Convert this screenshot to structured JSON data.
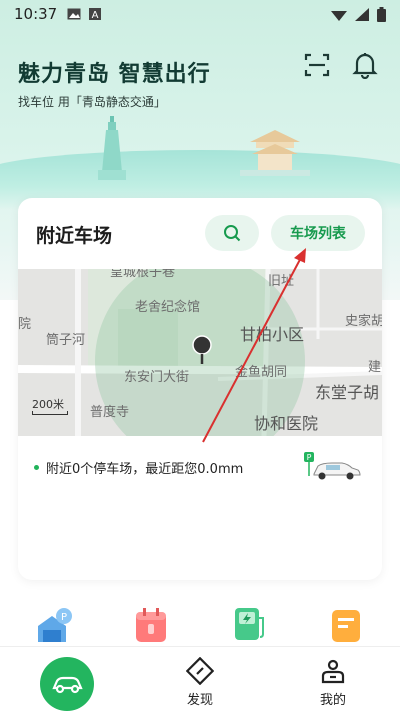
{
  "status_bar": {
    "time": "10:37",
    "left_icons": [
      "image-icon",
      "a-badge-icon"
    ],
    "right_icons": [
      "wifi-icon",
      "signal-icon",
      "battery-icon"
    ]
  },
  "header": {
    "title": "魅力青岛 智慧出行",
    "subtitle": "找车位 用「青岛静态交通」",
    "scan_icon": "scan-icon",
    "bell_icon": "bell-icon"
  },
  "nearby_card": {
    "title": "附近车场",
    "search_icon": "search-icon",
    "list_button_label": "车场列表",
    "map": {
      "labels": [
        "皇城根子巷",
        "旧址",
        "老舍纪念馆",
        "院",
        "筒子河",
        "甘柏小区",
        "史家胡",
        "建",
        "东安门大街",
        "金鱼胡同",
        "东堂子胡",
        "普度寺",
        "协和医院"
      ],
      "scale_label": "200米"
    },
    "summary_text": "附近0个停车场，最近距您0.0mm"
  },
  "quick_entries": [
    "parking-garage-icon",
    "calendar-icon",
    "charging-station-icon",
    "document-icon"
  ],
  "bottom_nav": {
    "home_icon": "car-icon",
    "discover_label": "发现",
    "mine_label": "我的"
  },
  "colors": {
    "brand_green": "#23b55f",
    "pill_bg": "#e8f5ee",
    "arrow_red": "#d9302f",
    "hero_teal": "#bfeee3"
  }
}
